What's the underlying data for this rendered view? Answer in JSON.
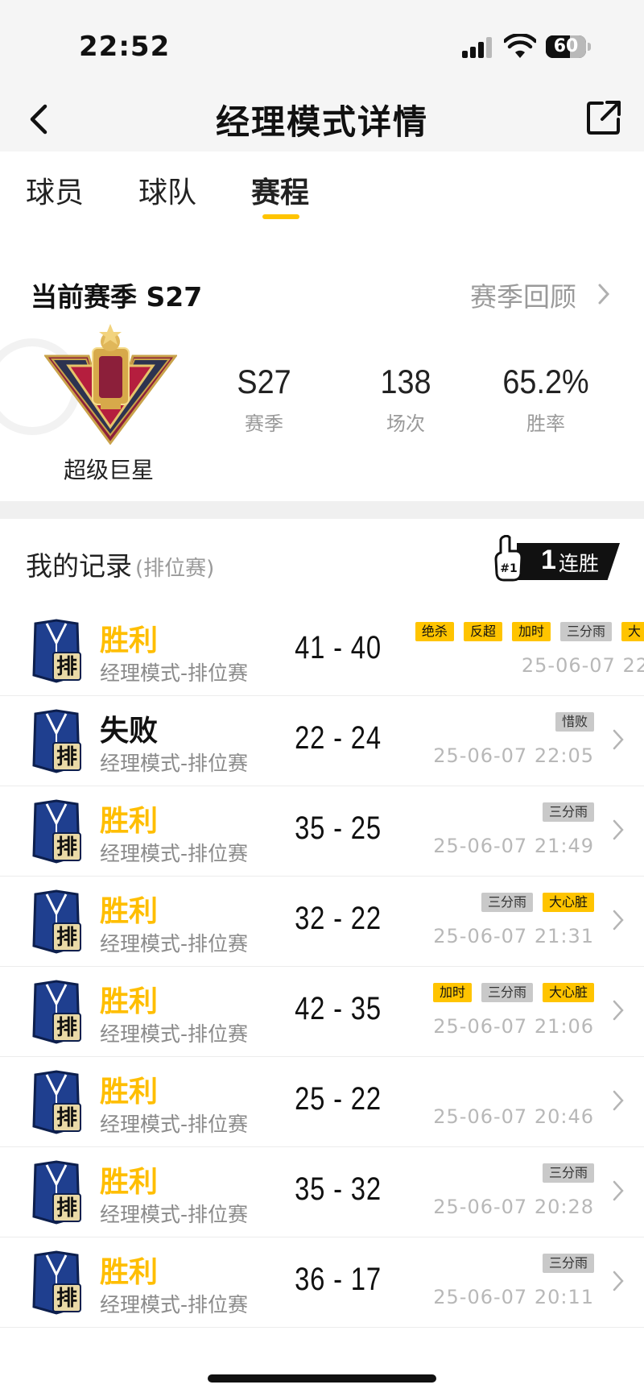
{
  "status_bar": {
    "time": "22:52",
    "battery": "60",
    "battery_level": 0.6
  },
  "header": {
    "title": "经理模式详情"
  },
  "tabs": [
    {
      "label": "球员",
      "active": false
    },
    {
      "label": "球队",
      "active": false
    },
    {
      "label": "赛程",
      "active": true
    }
  ],
  "season": {
    "title": "当前赛季 S27",
    "review_label": "赛季回顾",
    "rank_name": "超级巨星",
    "stats": [
      {
        "value": "S27",
        "label": "赛季"
      },
      {
        "value": "138",
        "label": "场次"
      },
      {
        "value": "65.2%",
        "label": "胜率"
      }
    ]
  },
  "records_section": {
    "title": "我的记录",
    "subtitle": "(排位赛)",
    "streak_number": "1",
    "streak_label": "连胜"
  },
  "records": [
    {
      "result": "胜利",
      "win": true,
      "mode": "经理模式-排位赛",
      "score": "41 - 40",
      "tags": [
        {
          "label": "绝杀",
          "style": "y"
        },
        {
          "label": "反超",
          "style": "y"
        },
        {
          "label": "加时",
          "style": "y"
        },
        {
          "label": "三分雨",
          "style": "g"
        },
        {
          "label": "大",
          "style": "y"
        }
      ],
      "time": "25-06-07 22"
    },
    {
      "result": "失败",
      "win": false,
      "mode": "经理模式-排位赛",
      "score": "22 - 24",
      "tags": [
        {
          "label": "惜败",
          "style": "g"
        }
      ],
      "time": "25-06-07 22:05"
    },
    {
      "result": "胜利",
      "win": true,
      "mode": "经理模式-排位赛",
      "score": "35 - 25",
      "tags": [
        {
          "label": "三分雨",
          "style": "g"
        }
      ],
      "time": "25-06-07 21:49"
    },
    {
      "result": "胜利",
      "win": true,
      "mode": "经理模式-排位赛",
      "score": "32 - 22",
      "tags": [
        {
          "label": "三分雨",
          "style": "g"
        },
        {
          "label": "大心脏",
          "style": "y"
        }
      ],
      "time": "25-06-07 21:31"
    },
    {
      "result": "胜利",
      "win": true,
      "mode": "经理模式-排位赛",
      "score": "42 - 35",
      "tags": [
        {
          "label": "加时",
          "style": "y"
        },
        {
          "label": "三分雨",
          "style": "g"
        },
        {
          "label": "大心脏",
          "style": "y"
        }
      ],
      "time": "25-06-07 21:06"
    },
    {
      "result": "胜利",
      "win": true,
      "mode": "经理模式-排位赛",
      "score": "25 - 22",
      "tags": [],
      "time": "25-06-07 20:46"
    },
    {
      "result": "胜利",
      "win": true,
      "mode": "经理模式-排位赛",
      "score": "35 - 32",
      "tags": [
        {
          "label": "三分雨",
          "style": "g"
        }
      ],
      "time": "25-06-07 20:28"
    },
    {
      "result": "胜利",
      "win": true,
      "mode": "经理模式-排位赛",
      "score": "36 - 17",
      "tags": [
        {
          "label": "三分雨",
          "style": "g"
        }
      ],
      "time": "25-06-07 20:11"
    }
  ],
  "mode_icon_text": "排",
  "colors": {
    "accent": "#ffc400",
    "win": "#ffbe00",
    "muted": "#9a9a9a"
  }
}
